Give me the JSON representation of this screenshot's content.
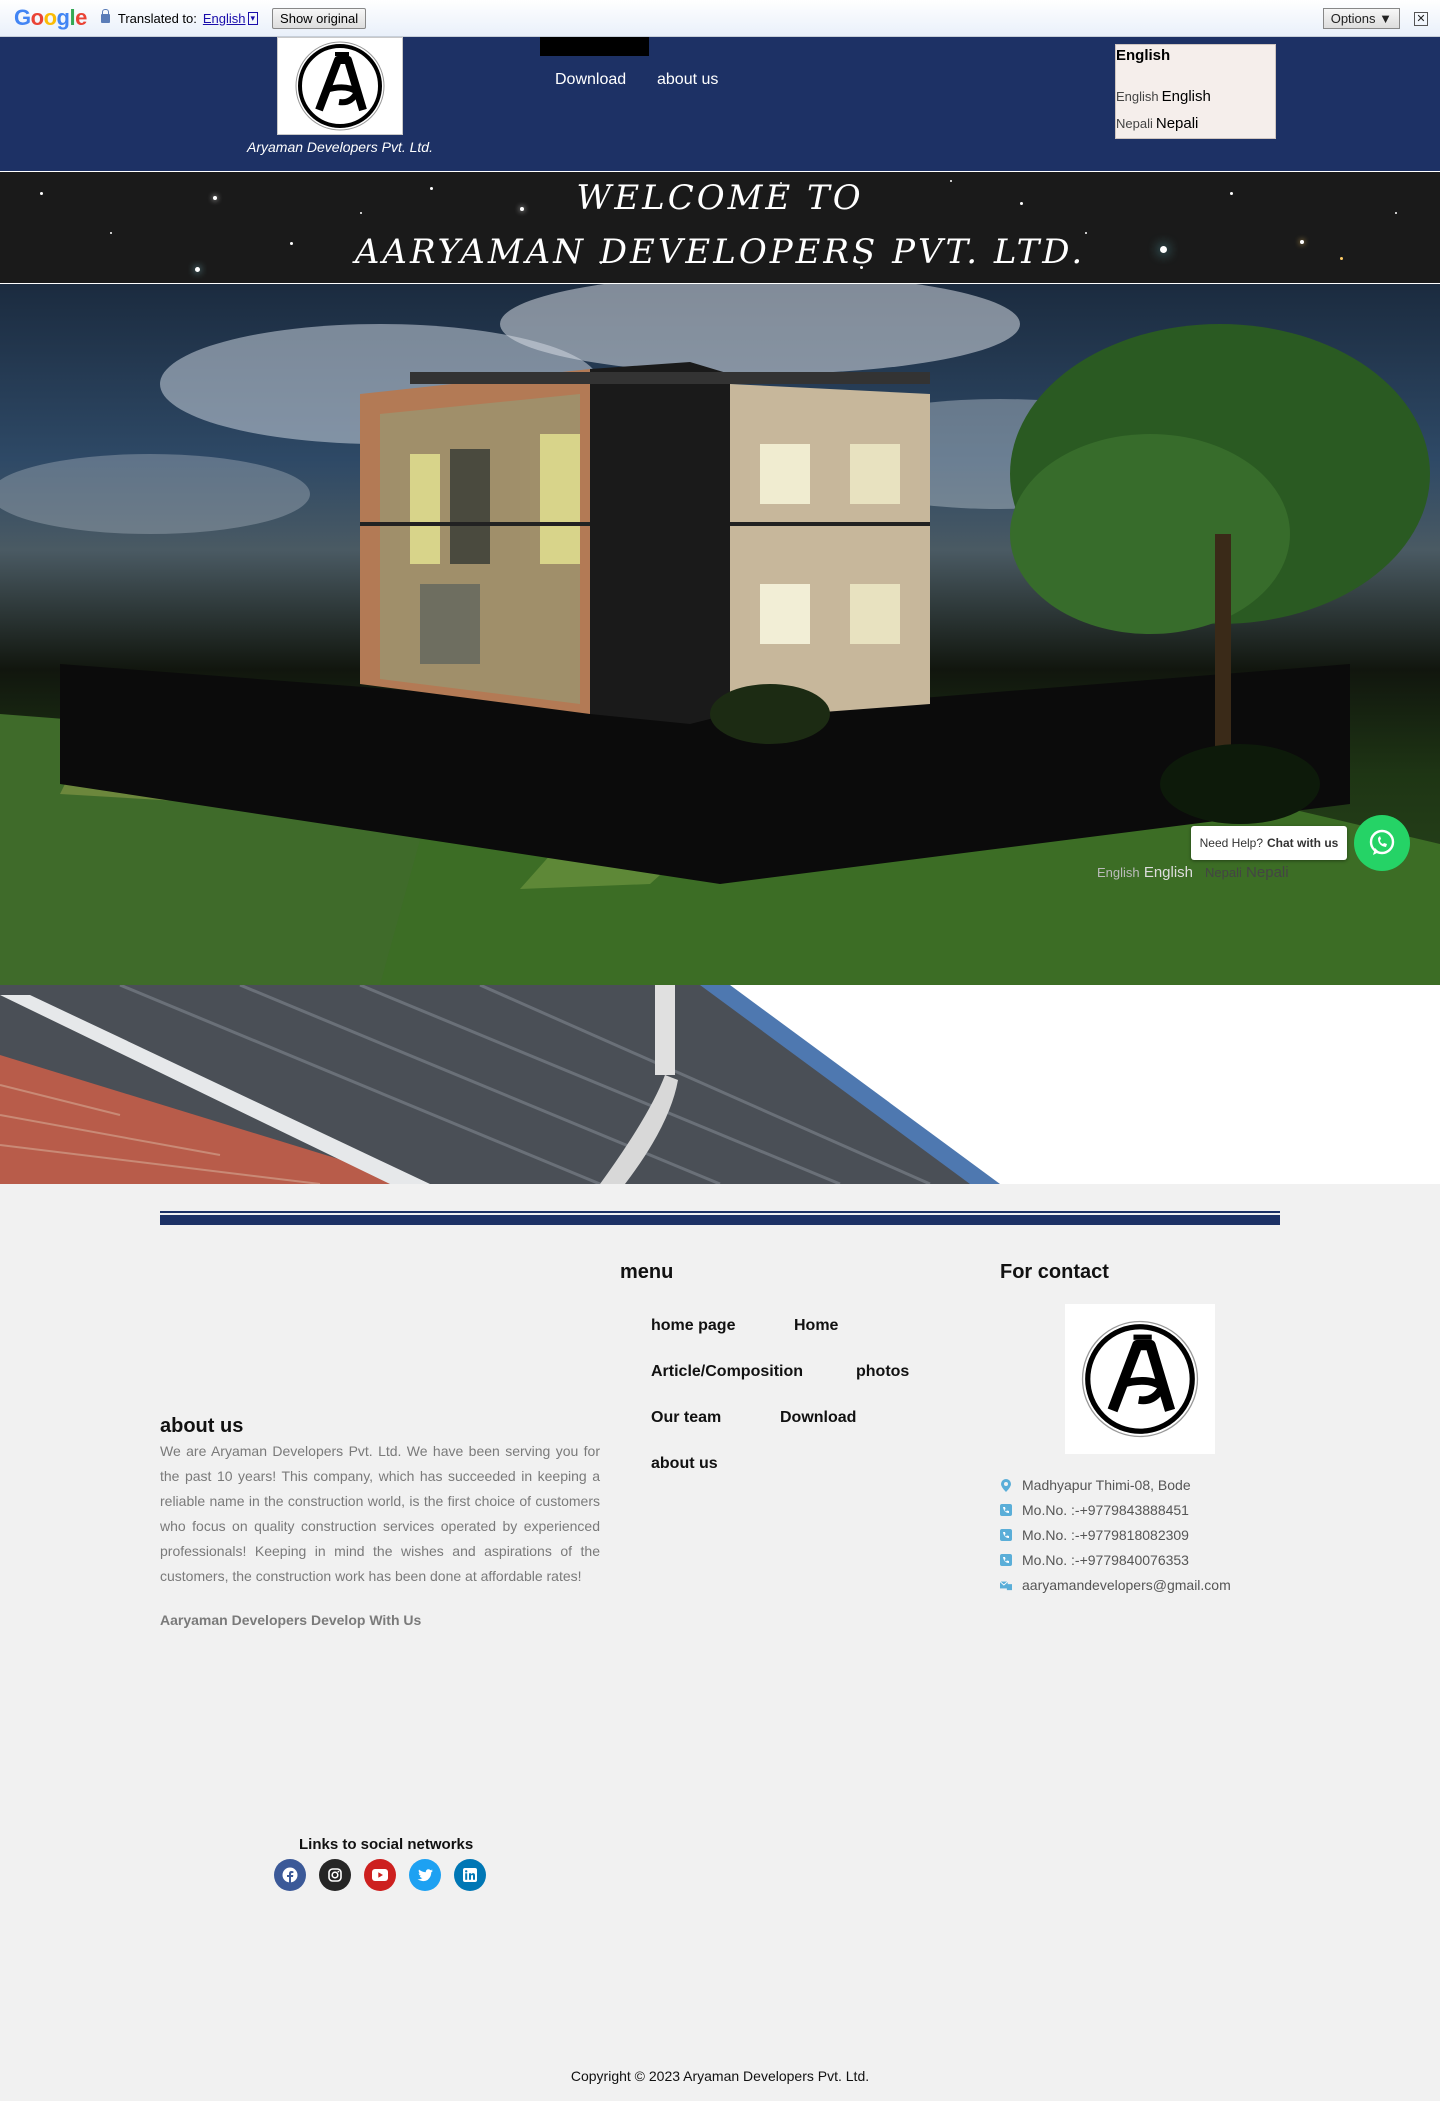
{
  "translate_bar": {
    "logo": "Google",
    "translated_to_label": "Translated to:",
    "language": "English",
    "dropdown_glyph": "▾",
    "show_original": "Show original",
    "options": "Options ▼",
    "close_glyph": "✕"
  },
  "header": {
    "company_caption": "Aryaman Developers Pvt. Ltd.",
    "nav": [
      {
        "label": "Download"
      },
      {
        "label": "about us"
      }
    ],
    "language_box": {
      "title": "English",
      "options": [
        {
          "alt": "English",
          "label": "English"
        },
        {
          "alt": "Nepali",
          "label": "Nepali"
        }
      ]
    }
  },
  "welcome": {
    "line1": "WELCOME TO",
    "line2": "AARYAMAN DEVELOPERS PVT. LTD."
  },
  "hero": {
    "whatsapp_tip_prefix": "Need Help?",
    "whatsapp_tip_bold": "Chat with us",
    "langs": [
      {
        "alt": "English",
        "label": "English"
      },
      {
        "alt": "Nepali",
        "label": "Nepali"
      }
    ]
  },
  "footer": {
    "about": {
      "title": "about us",
      "text": "We are Aryaman Developers Pvt. Ltd. We have been serving you for the past 10 years! This company, which has succeeded in keeping a reliable name in the construction world, is the first choice of customers who focus on quality construction services operated by experienced professionals! Keeping in mind the wishes and aspirations of the customers, the construction work has been done at affordable rates!",
      "tagline": "Aaryaman Developers Develop With Us"
    },
    "menu": {
      "title": "menu",
      "items": [
        {
          "label": "home page"
        },
        {
          "label": "Home"
        },
        {
          "label": "Article/Composition"
        },
        {
          "label": "photos"
        },
        {
          "label": "Our team"
        },
        {
          "label": "Download"
        },
        {
          "label": "about us"
        }
      ]
    },
    "contact": {
      "title": "For contact",
      "rows": [
        {
          "icon": "map-marker-icon",
          "text": "Madhyapur Thimi-08, Bode"
        },
        {
          "icon": "phone-icon",
          "text": "Mo.No. :-+9779843888451"
        },
        {
          "icon": "phone-icon",
          "text": "Mo.No. :-+9779818082309"
        },
        {
          "icon": "phone-icon",
          "text": "Mo.No. :-+9779840076353"
        },
        {
          "icon": "mail-icon",
          "text": "aaryamandevelopers@gmail.com"
        }
      ]
    },
    "social": {
      "title": "Links to social networks",
      "links": [
        {
          "name": "facebook-icon",
          "color": "#3b5998"
        },
        {
          "name": "instagram-icon",
          "color": "#262626"
        },
        {
          "name": "youtube-icon",
          "color": "#cd201f"
        },
        {
          "name": "twitter-icon",
          "color": "#1da1f2"
        },
        {
          "name": "linkedin-icon",
          "color": "#0077b5"
        }
      ]
    },
    "copyright": "Copyright © 2023 Aryaman Developers Pvt. Ltd."
  },
  "colors": {
    "header_bg": "#1d3165",
    "whatsapp": "#25d366",
    "contact_icon": "#5aaed8"
  }
}
